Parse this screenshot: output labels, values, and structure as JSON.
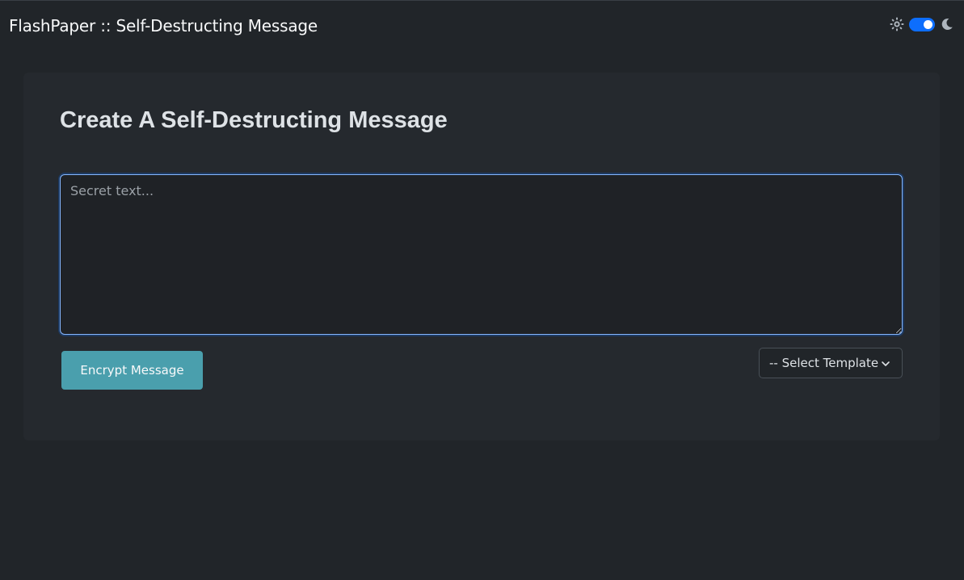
{
  "app": {
    "title": "FlashPaper :: Self-Destructing Message"
  },
  "theme_switch": {
    "light_icon": "sun-icon",
    "dark_icon": "moon-icon",
    "mode": "dark",
    "accent": "#0d6efd"
  },
  "main": {
    "heading": "Create A Self-Destructing Message",
    "secret_input": {
      "placeholder": "Secret text...",
      "value": ""
    },
    "encrypt_button": {
      "label": "Encrypt Message",
      "color": "#4a9fad"
    },
    "template_select": {
      "selected": "-- Select Template",
      "icon": "chevron-down-icon"
    }
  }
}
